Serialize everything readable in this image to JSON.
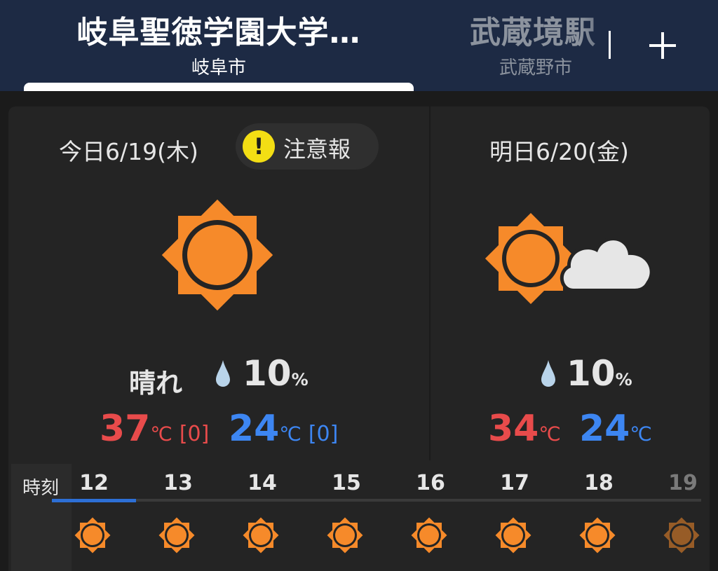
{
  "tabs": [
    {
      "name": "岐阜聖徳学園大学…",
      "city": "岐阜市",
      "active": true
    },
    {
      "name": "武蔵境駅",
      "city": "武蔵野市",
      "active": false
    }
  ],
  "add_location_icon": "plus-icon",
  "today": {
    "label": "今日6/19(木)",
    "warning": {
      "icon": "exclamation-icon",
      "text": "注意報",
      "color": "#f3de14"
    },
    "weather_icon": "sunny-icon",
    "weather_text": "晴れ",
    "rain_icon": "raindrop-icon",
    "precip": "10",
    "precip_unit": "%",
    "high": "37",
    "high_unit": "℃",
    "high_diff": "[0]",
    "low": "24",
    "low_unit": "℃",
    "low_diff": "[0]"
  },
  "tomorrow": {
    "label": "明日6/20(金)",
    "weather_icon": "sunny-then-cloudy-icon",
    "rain_icon": "raindrop-icon",
    "precip": "10",
    "precip_unit": "%",
    "high": "34",
    "high_unit": "℃",
    "low": "24",
    "low_unit": "℃"
  },
  "hourly": {
    "label": "時刻",
    "hours": [
      "12",
      "13",
      "14",
      "15",
      "16",
      "17",
      "18",
      "19"
    ],
    "icon": "sunny-icon",
    "progress": 0.13
  },
  "colors": {
    "header": "#1d2a44",
    "high": "#e84b4b",
    "low": "#3d86f2",
    "sun": "#f68a2a",
    "accent": "#2d6fd6"
  }
}
